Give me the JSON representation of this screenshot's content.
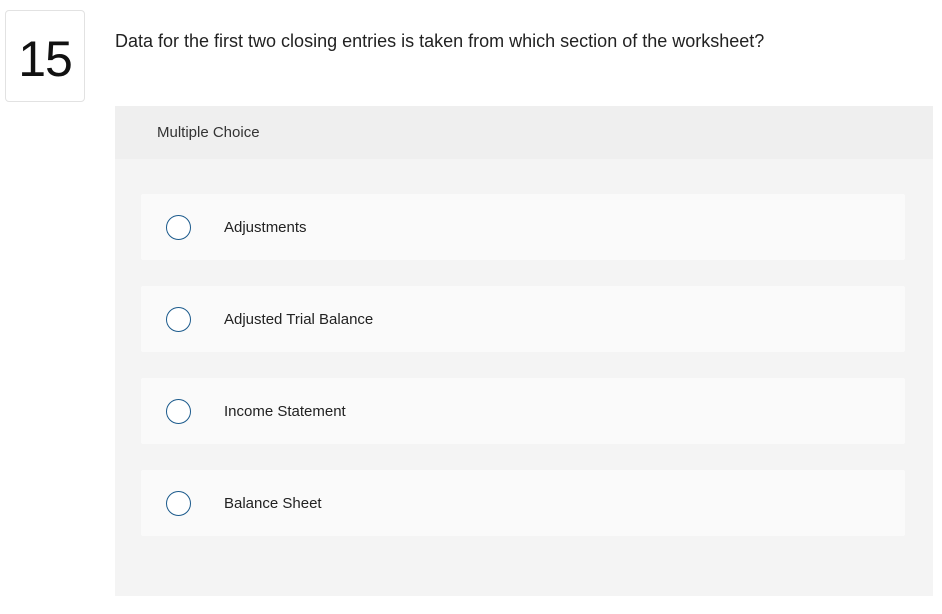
{
  "question": {
    "number": "15",
    "text": "Data for the first two closing entries is taken from which section of the worksheet?"
  },
  "panel": {
    "header": "Multiple Choice",
    "options": [
      {
        "label": "Adjustments"
      },
      {
        "label": "Adjusted Trial Balance"
      },
      {
        "label": "Income Statement"
      },
      {
        "label": "Balance Sheet"
      }
    ]
  },
  "colors": {
    "radio_border": "#1b5a8c",
    "panel_bg": "#f4f4f4",
    "option_bg": "#fafafa"
  },
  "icons": {
    "radio": "radio-unselected-icon"
  }
}
